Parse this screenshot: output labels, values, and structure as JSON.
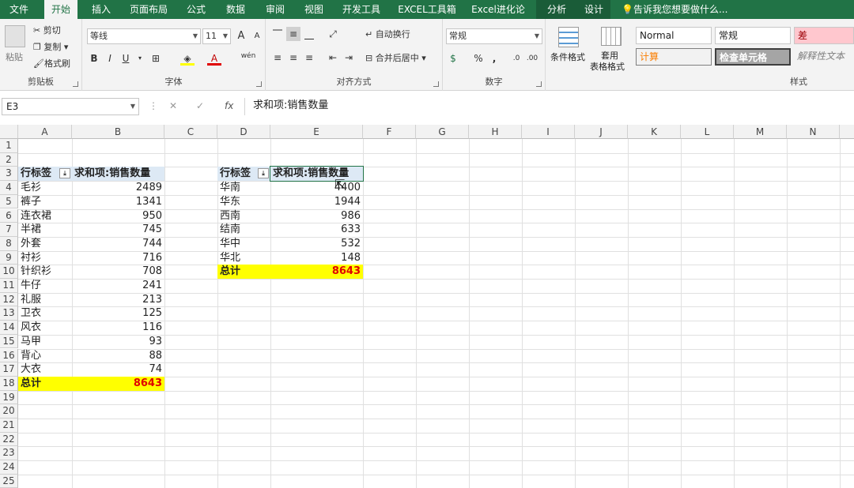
{
  "tabs": [
    "文件",
    "开始",
    "插入",
    "页面布局",
    "公式",
    "数据",
    "审阅",
    "视图",
    "开发工具",
    "EXCEL工具箱",
    "Excel进化论",
    "分析",
    "设计"
  ],
  "tell_me": "告诉我您想要做什么...",
  "ribbon": {
    "clipboard": {
      "paste": "粘贴",
      "cut": "剪切",
      "copy": "复制",
      "format_painter": "格式刷",
      "label": "剪贴板"
    },
    "font": {
      "name": "等线",
      "size": "11",
      "grow": "A",
      "shrink": "A",
      "bold": "B",
      "italic": "I",
      "underline": "U",
      "phonetic": "wén",
      "label": "字体"
    },
    "alignment": {
      "wrap": "自动换行",
      "merge": "合并后居中",
      "label": "对齐方式"
    },
    "number": {
      "format": "常规",
      "percent": "%",
      "comma": ",",
      "label": "数字"
    },
    "styles": {
      "conditional": "条件格式",
      "table_format_1": "套用",
      "table_format_2": "表格格式",
      "normal": "Normal",
      "general": "常规",
      "bad": "差",
      "calc": "计算",
      "check": "检查单元格",
      "explain": "解释性文本",
      "label": "样式"
    }
  },
  "formula_bar": {
    "name_box": "E3",
    "cancel": "✕",
    "enter": "✓",
    "fx": "fx",
    "formula": "求和项:销售数量"
  },
  "columns": [
    "A",
    "B",
    "C",
    "D",
    "E",
    "F",
    "G",
    "H",
    "I",
    "J",
    "K",
    "L",
    "M",
    "N"
  ],
  "rows": [
    "1",
    "2",
    "3",
    "4",
    "5",
    "6",
    "7",
    "8",
    "9",
    "10",
    "11",
    "12",
    "13",
    "14",
    "15",
    "16",
    "17",
    "18",
    "19",
    "20",
    "21",
    "22",
    "23",
    "24",
    "25"
  ],
  "pivot1": {
    "row_label": "行标签",
    "value_label": "求和项:销售数量",
    "items": [
      {
        "label": "毛衫",
        "value": "2489"
      },
      {
        "label": "裤子",
        "value": "1341"
      },
      {
        "label": "连衣裙",
        "value": "950"
      },
      {
        "label": "半裙",
        "value": "745"
      },
      {
        "label": "外套",
        "value": "744"
      },
      {
        "label": "衬衫",
        "value": "716"
      },
      {
        "label": "针织衫",
        "value": "708"
      },
      {
        "label": "牛仔",
        "value": "241"
      },
      {
        "label": "礼服",
        "value": "213"
      },
      {
        "label": "卫衣",
        "value": "125"
      },
      {
        "label": "风衣",
        "value": "116"
      },
      {
        "label": "马甲",
        "value": "93"
      },
      {
        "label": "背心",
        "value": "88"
      },
      {
        "label": "大衣",
        "value": "74"
      }
    ],
    "total_label": "总计",
    "total_value": "8643"
  },
  "pivot2": {
    "row_label": "行标签",
    "value_label": "求和项:销售数量",
    "items": [
      {
        "label": "华南",
        "value": "4400"
      },
      {
        "label": "华东",
        "value": "1944"
      },
      {
        "label": "西南",
        "value": "986"
      },
      {
        "label": "结南",
        "value": "633"
      },
      {
        "label": "华中",
        "value": "532"
      },
      {
        "label": "华北",
        "value": "148"
      }
    ],
    "total_label": "总计",
    "total_value": "8643"
  },
  "colors": {
    "excel_green": "#217346",
    "total_fill": "#ffff00",
    "total_text": "#e00000",
    "header_fill": "#dde9f5"
  }
}
